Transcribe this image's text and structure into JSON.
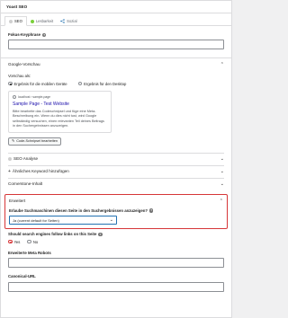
{
  "metabox_title": "Yoast SEO",
  "tabs": [
    {
      "label": "SEO",
      "dot_color": "#cfcfcf"
    },
    {
      "label": "Lesbarkeit",
      "dot_color": "#7ad03a"
    },
    {
      "label": "Sozial",
      "dot_color": "#2271b1"
    }
  ],
  "focus_keyphrase": {
    "label": "Fokus-Keyphrase",
    "value": ""
  },
  "google_preview": {
    "title": "Google-Vorschau",
    "preview_as_label": "Vorschau als:",
    "options": [
      "Ergebnis für die mobilen Geräte",
      "Ergebnis für den Desktop"
    ],
    "selected_option": 0,
    "breadcrumb": "localhost › sample-page",
    "page_title": "Sample Page - Test Website",
    "description": "Bitte bearbeite das Codeschnipsel und füge eine Meta-Beschreibung ein. Wenn du dies nicht tust, wird Google selbständig versuchen, einen relevanten Teil deines Beitrags in den Suchergebnissen anzuzeigen.",
    "edit_button": "Code-Schnipsel bearbeiten"
  },
  "sections": [
    {
      "title": "SEO Analyse",
      "icon": "status-dot-icon"
    },
    {
      "title": "Ähnliches Keyword hinzufügen",
      "icon": "plus-icon"
    },
    {
      "title": "Cornerstone-Inhalt",
      "icon": ""
    }
  ],
  "advanced": {
    "title": "Erweitert",
    "search_question": "Erlaube Suchmaschinen diesen Seite in den Suchergebnissen anzuzeigen?",
    "search_value": "Ja (current default for Seiten)",
    "follow_question": "Should search engines follow links on this Seite",
    "follow_options": [
      "Yes",
      "No"
    ],
    "follow_selected": 0,
    "meta_robots_label": "Erweiterte Meta Robots",
    "canonical_label": "Canonical-URL"
  },
  "colors": {
    "accent": "#2271b1",
    "highlight": "#d63638"
  }
}
